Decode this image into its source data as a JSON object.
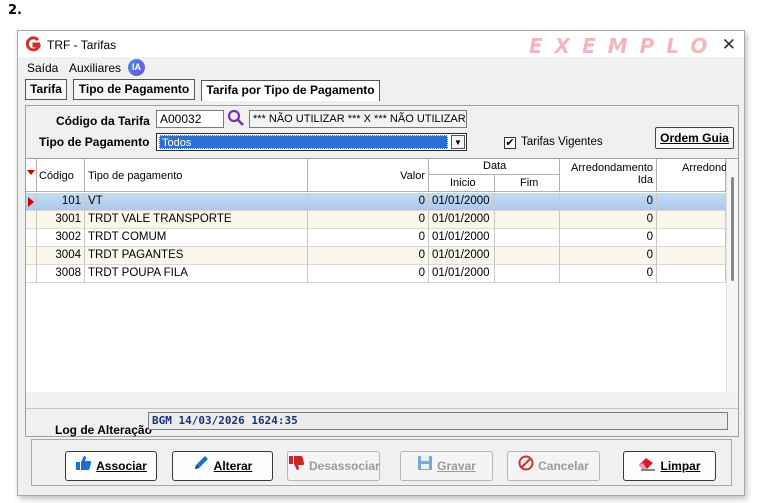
{
  "page_label": "2.",
  "window": {
    "title": "TRF - Tarifas",
    "watermark": "EXEMPLO",
    "close_glyph": "✕"
  },
  "menu": [
    "Saída",
    "Auxiliares"
  ],
  "ia_badge": "IA",
  "tabs": [
    {
      "label": "Tarifa",
      "active": false
    },
    {
      "label": "Tipo de Pagamento",
      "active": false
    },
    {
      "label": "Tarifa por Tipo de Pagamento",
      "active": true
    }
  ],
  "form": {
    "codigo_tarifa_label": "Código da Tarifa",
    "codigo_tarifa_value": "A00032",
    "tarifa_desc_value": "*** NÃO UTILIZAR *** X *** NÃO UTILIZAR",
    "tipo_pagamento_label": "Tipo de Pagamento",
    "tipo_pagamento_value": "Todos",
    "tarifas_vigentes_label": "Tarifas Vigentes",
    "tarifas_vigentes_checked": true,
    "ordem_guia_label": "Ordem Guia"
  },
  "grid": {
    "headers": {
      "codigo": "Código",
      "tipo": "Tipo de pagamento",
      "valor": "Valor",
      "data": "Data",
      "inicio": "Inicio",
      "fim": "Fim",
      "arred_ida": "Arredondamento Ida",
      "arred_volta": "Arredonda"
    },
    "rows": [
      {
        "codigo": "101",
        "tipo": "VT",
        "valor": "0",
        "inicio": "01/01/2000",
        "fim": "",
        "arred": "0",
        "selected": true
      },
      {
        "codigo": "3001",
        "tipo": "TRDT VALE TRANSPORTE",
        "valor": "0",
        "inicio": "01/01/2000",
        "fim": "",
        "arred": "0",
        "selected": false
      },
      {
        "codigo": "3002",
        "tipo": "TRDT COMUM",
        "valor": "0",
        "inicio": "01/01/2000",
        "fim": "",
        "arred": "0",
        "selected": false
      },
      {
        "codigo": "3004",
        "tipo": "TRDT PAGANTES",
        "valor": "0",
        "inicio": "01/01/2000",
        "fim": "",
        "arred": "0",
        "selected": false
      },
      {
        "codigo": "3008",
        "tipo": "TRDT POUPA FILA",
        "valor": "0",
        "inicio": "01/01/2000",
        "fim": "",
        "arred": "0",
        "selected": false
      }
    ]
  },
  "log": {
    "label": "Log de Alteração",
    "value": "BGM 14/03/2026 1624:35"
  },
  "actions": {
    "associar": "Associar",
    "alterar": "Alterar",
    "desassociar": "Desassociar",
    "gravar": "Gravar",
    "cancelar": "Cancelar",
    "limpar": "Limpar"
  },
  "colors": {
    "selection_blue": "#2a6fd1",
    "associar_icon": "#1e6fd0",
    "desassociar_icon": "#c62828",
    "cancelar_icon": "#d32f2f",
    "limpar_icon": "#d81b2f"
  }
}
